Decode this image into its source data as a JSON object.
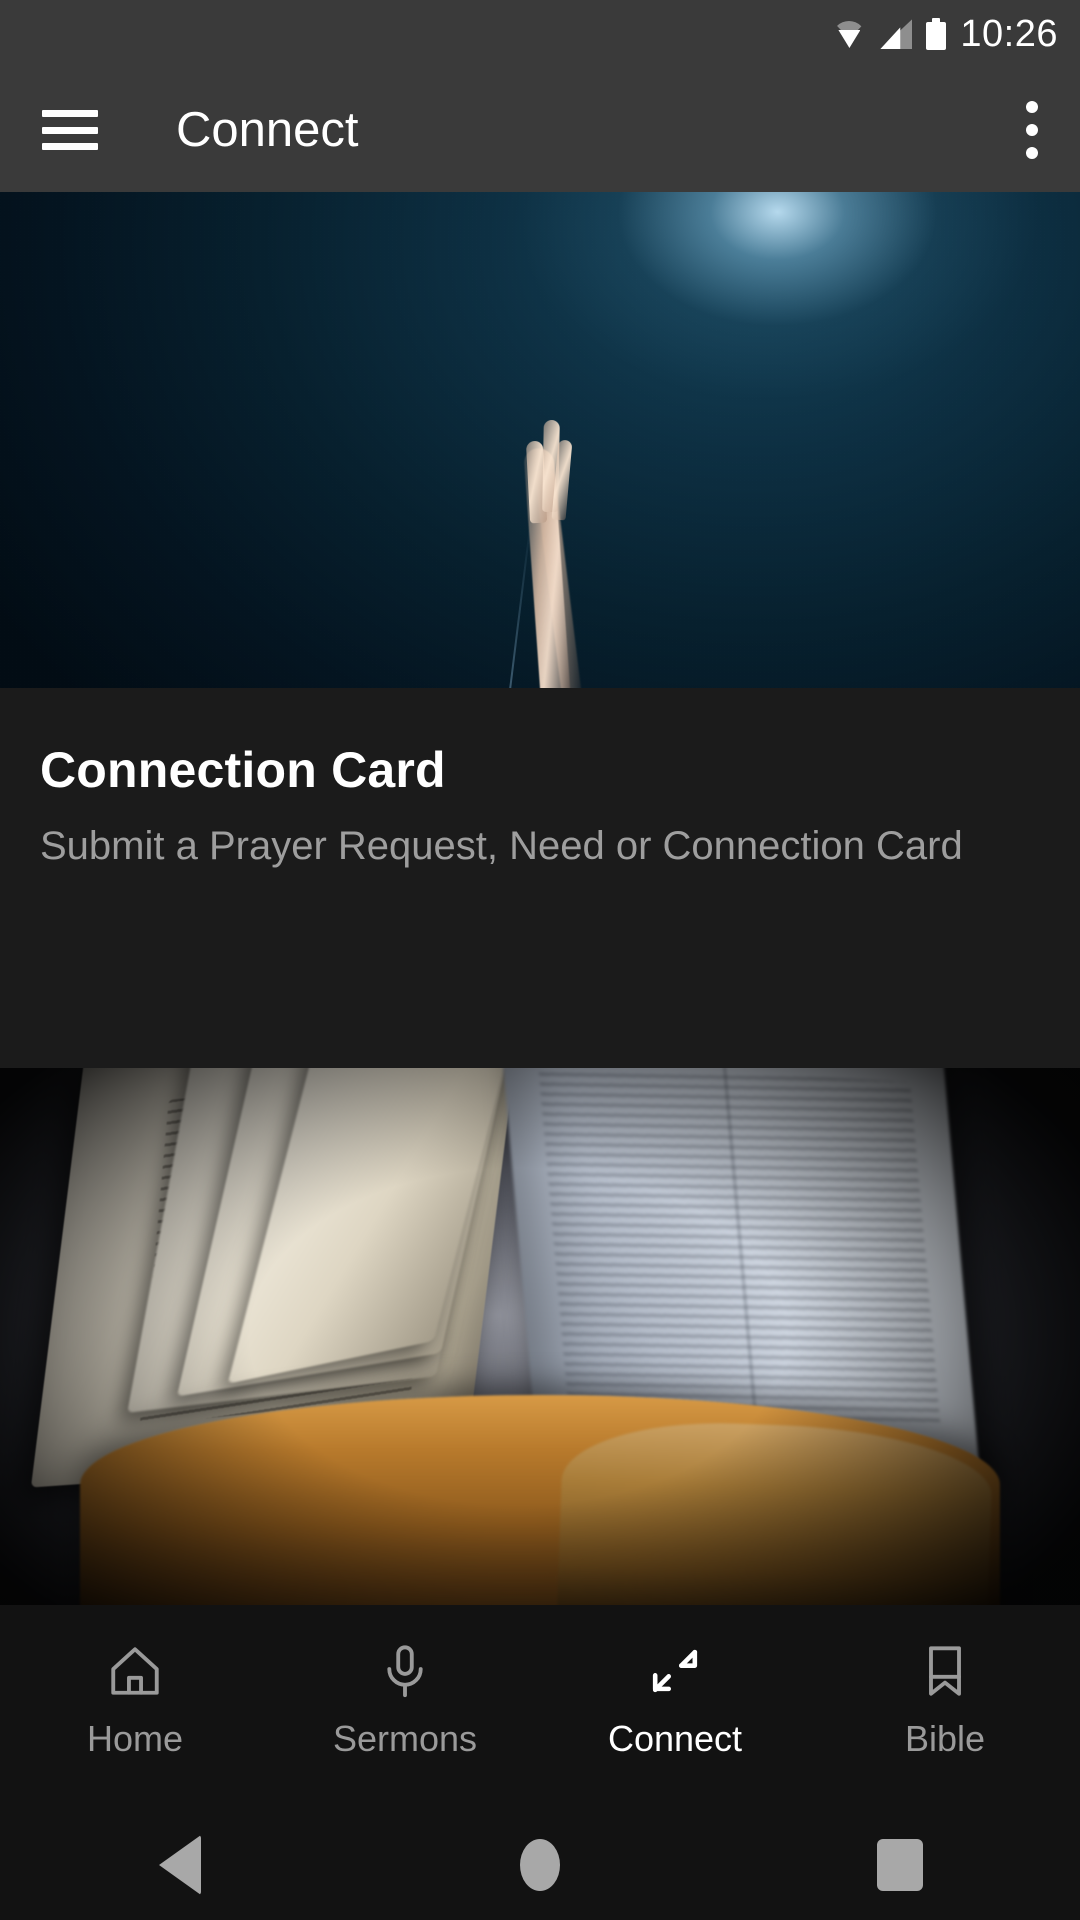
{
  "status_bar": {
    "time": "10:26",
    "icons": [
      "wifi-icon",
      "cellular-signal-icon",
      "battery-icon"
    ]
  },
  "toolbar": {
    "menu_icon": "hamburger-menu-icon",
    "title": "Connect",
    "overflow_icon": "more-vertical-icon"
  },
  "hero": {
    "alt": "raised-hand-toward-light-photo"
  },
  "card": {
    "title": "Connection Card",
    "subtitle": "Submit a Prayer Request, Need or Connection Card"
  },
  "second_item": {
    "alt": "open-bible-photo"
  },
  "tabs": [
    {
      "label": "Home",
      "icon": "home-icon",
      "active": false
    },
    {
      "label": "Sermons",
      "icon": "microphone-icon",
      "active": false
    },
    {
      "label": "Connect",
      "icon": "compress-arrows-icon",
      "active": true
    },
    {
      "label": "Bible",
      "icon": "book-icon",
      "active": false
    }
  ],
  "system_nav": {
    "back": "back-triangle-icon",
    "home": "home-circle-icon",
    "recents": "recents-square-icon"
  },
  "colors": {
    "status_bar_bg": "#3a3a3a",
    "toolbar_bg": "#3a3a3a",
    "card_bg": "#1b1b1b",
    "tabbar_bg": "#121212",
    "active_tab": "#ffffff",
    "inactive_tab": "#9a9a9a",
    "subtitle": "#9e9e9e"
  }
}
